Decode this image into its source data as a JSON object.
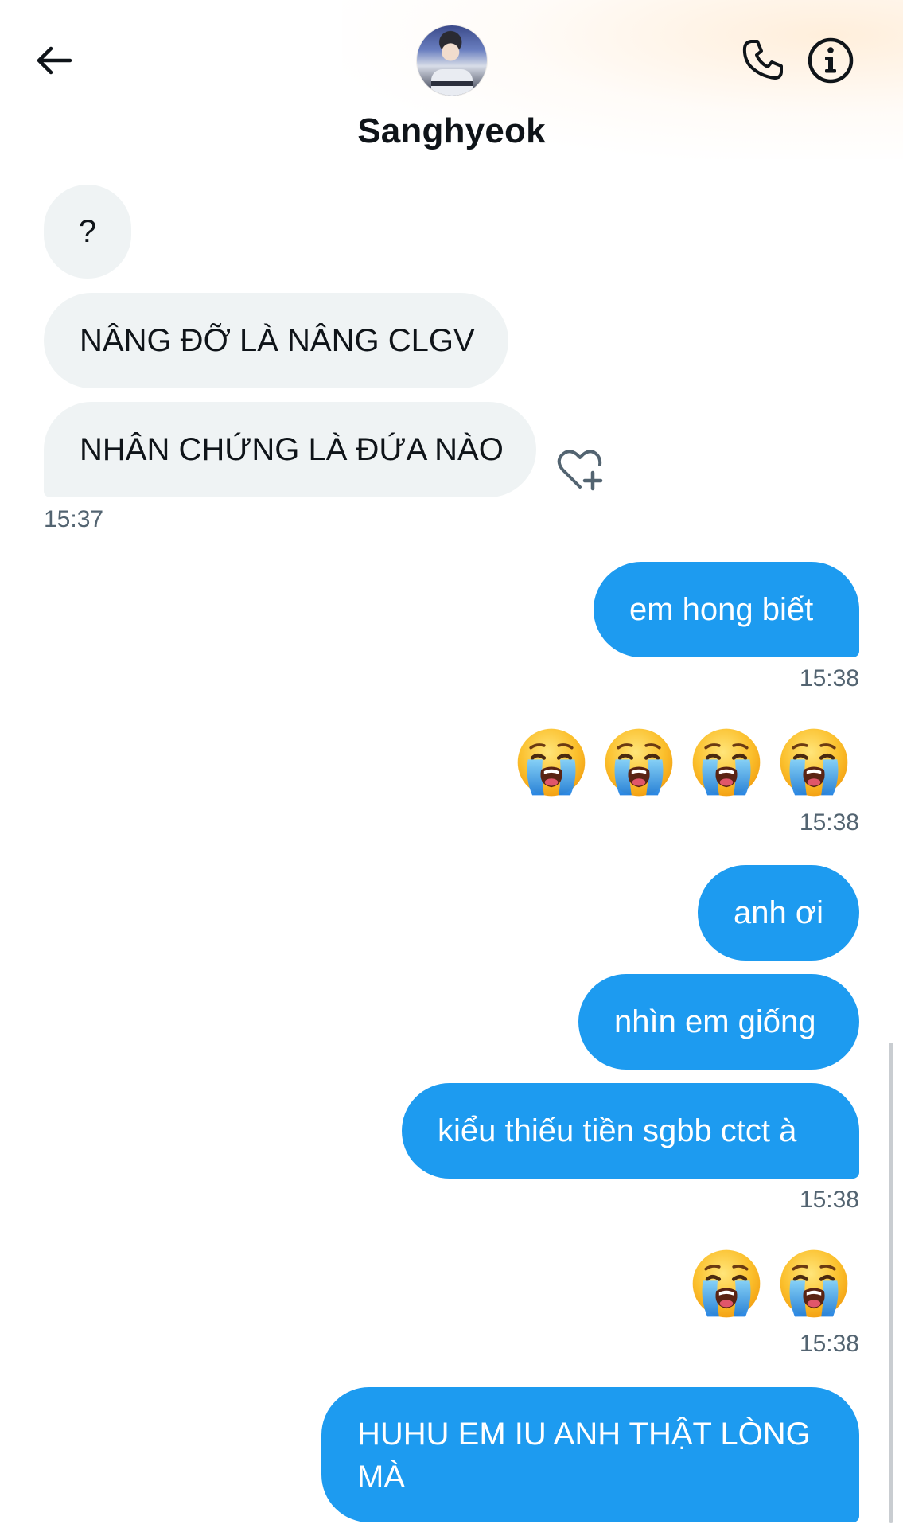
{
  "header": {
    "contact_name": "Sanghyeok"
  },
  "messages": [
    {
      "side": "in",
      "text": "?"
    },
    {
      "side": "in",
      "text": "NÂNG ĐỠ LÀ NÂNG CLGV"
    },
    {
      "side": "in",
      "text": "NHÂN CHỨNG LÀ ĐỨA NÀO",
      "time": "15:37"
    },
    {
      "side": "out",
      "text": "em hong biết",
      "time": "15:38"
    },
    {
      "side": "out",
      "emoji": "loudly-crying-face",
      "count": 4,
      "time": "15:38"
    },
    {
      "side": "out",
      "text": "anh ơi"
    },
    {
      "side": "out",
      "text": "nhìn em giống"
    },
    {
      "side": "out",
      "text": "kiểu thiếu tiền sgbb ctct à",
      "time": "15:38"
    },
    {
      "side": "out",
      "emoji": "loudly-crying-face",
      "count": 2,
      "time": "15:38"
    },
    {
      "side": "out",
      "text": "HUHU EM IU ANH THẬT LÒNG MÀ"
    }
  ],
  "colors": {
    "outgoing_bubble": "#1d9bf0",
    "incoming_bubble": "#eff3f4",
    "timestamp": "#536471",
    "text": "#0f1419"
  },
  "icons": [
    "back-arrow-icon",
    "phone-icon",
    "info-icon",
    "heart-plus-icon",
    "loudly-crying-face-emoji"
  ]
}
